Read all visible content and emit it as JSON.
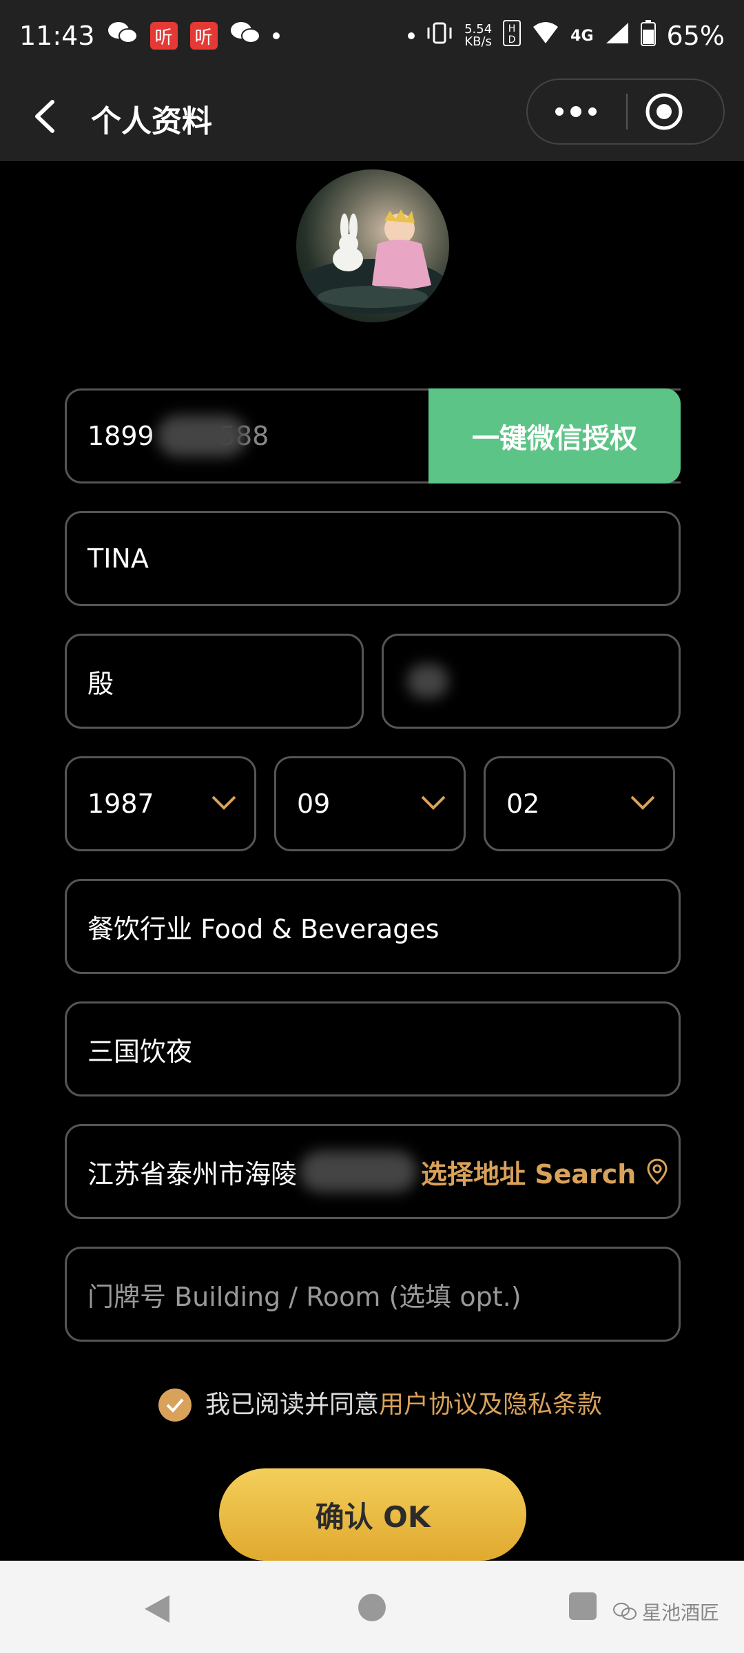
{
  "status_bar": {
    "time": "11:43",
    "net_speed_value": "5.54",
    "net_speed_unit": "KB/s",
    "network": "4G",
    "battery": "65%"
  },
  "header": {
    "title": "个人资料"
  },
  "form": {
    "phone_prefix": "1899",
    "phone_suffix": "588",
    "wechat_auth_label": "一键微信授权",
    "first_name": "TINA",
    "last_name": "殷",
    "birth_year": "1987",
    "birth_month": "09",
    "birth_day": "02",
    "industry": "餐饮行业 Food & Beverages",
    "company": "三国饮夜",
    "address_prefix": "江苏省泰州市海陵",
    "address_search_label": "选择地址 Search",
    "room_placeholder": "门牌号 Building / Room (选填 opt.)"
  },
  "agreement": {
    "text": "我已阅读并同意",
    "link": "用户协议及隐私条款"
  },
  "ok_button_label": "确认 OK",
  "watermark": "星池酒匠",
  "colors": {
    "accent_green": "#5cc486",
    "accent_gold": "#d9a25a",
    "button_gold": "#f3cf5a"
  }
}
